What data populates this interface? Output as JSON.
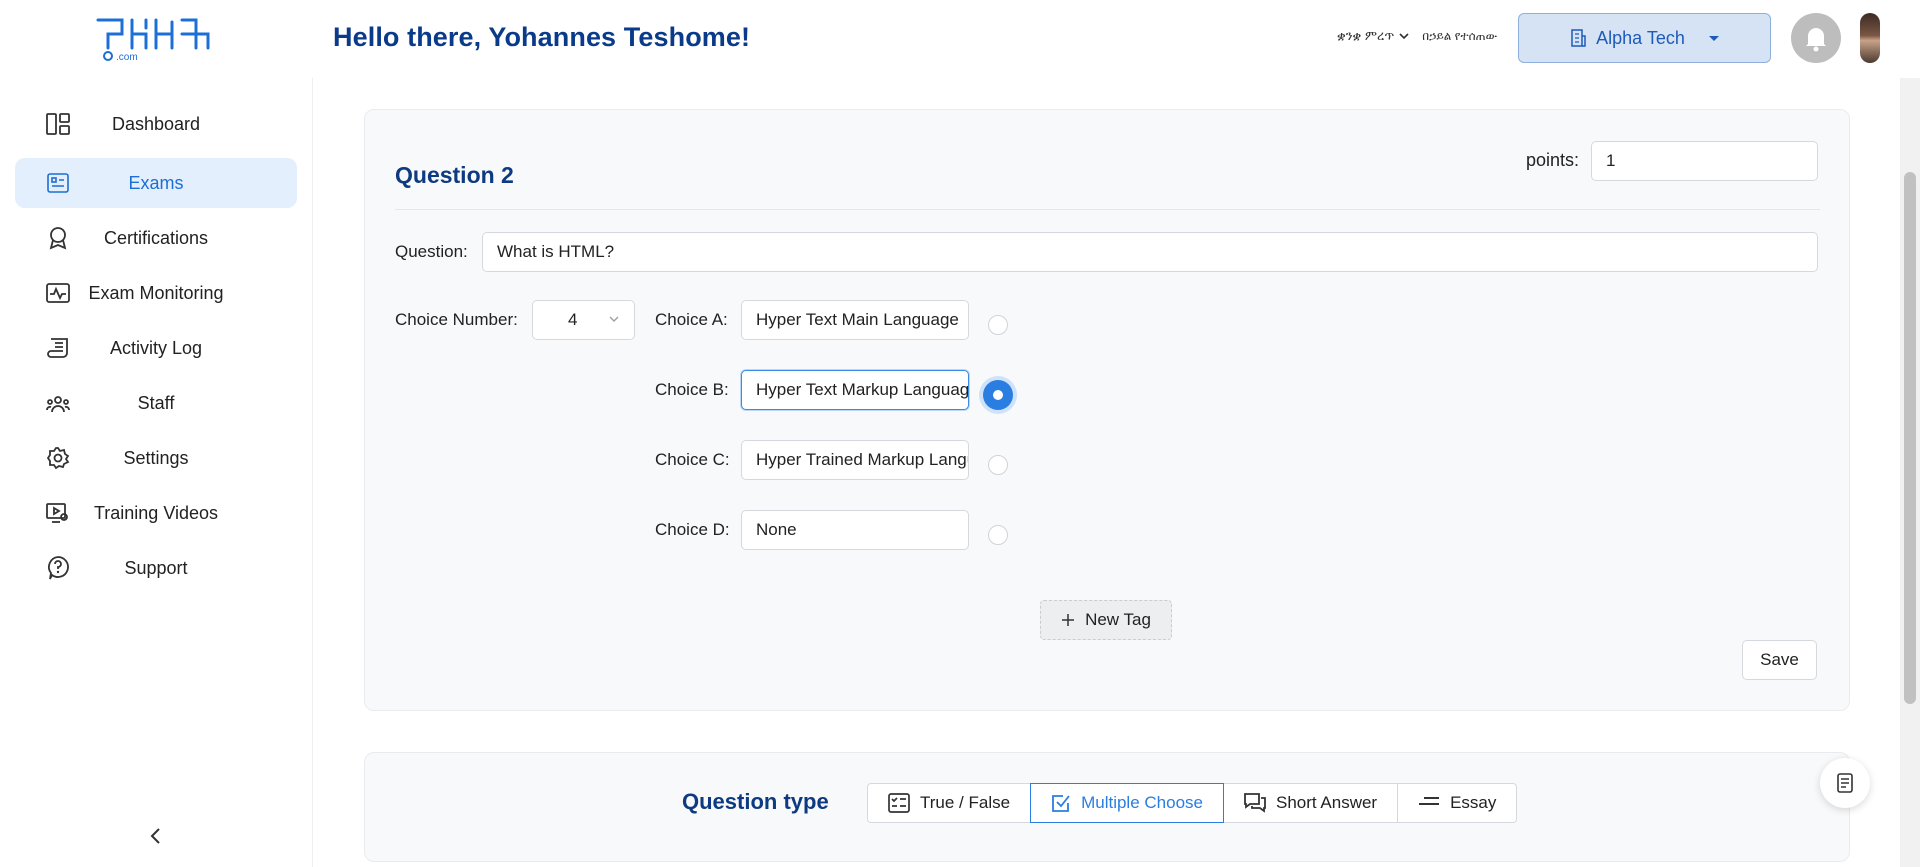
{
  "header": {
    "greeting": "Hello there, Yohannes Teshome!",
    "language_label": "ቋንቋ ምረጥ",
    "faq_label": "በኃይል የተሰጠው",
    "company_button": "Alpha Tech"
  },
  "sidebar": {
    "items": [
      {
        "label": "Dashboard",
        "icon": "dashboard-icon"
      },
      {
        "label": "Exams",
        "icon": "exam-icon",
        "active": true
      },
      {
        "label": "Certifications",
        "icon": "award-icon"
      },
      {
        "label": "Exam Monitoring",
        "icon": "monitor-icon"
      },
      {
        "label": "Activity Log",
        "icon": "log-icon"
      },
      {
        "label": "Staff",
        "icon": "staff-icon"
      },
      {
        "label": "Settings",
        "icon": "gear-icon"
      },
      {
        "label": "Training Videos",
        "icon": "video-icon"
      },
      {
        "label": "Support",
        "icon": "help-icon"
      }
    ]
  },
  "question": {
    "title": "Question 2",
    "points_label": "points",
    "points_value": "1",
    "question_label": "Question",
    "question_value": "What is HTML?",
    "choice_number_label": "Choice Number",
    "choice_number_value": "4",
    "choices": [
      {
        "label": "Choice A",
        "value": "Hyper Text Main Language",
        "correct": false
      },
      {
        "label": "Choice B",
        "value": "Hyper Text Markup Language",
        "correct": true
      },
      {
        "label": "Choice C",
        "value": "Hyper Trained Markup Language",
        "correct": false
      },
      {
        "label": "Choice D",
        "value": "None",
        "correct": false
      }
    ],
    "new_tag_label": "New Tag",
    "save_label": "Save"
  },
  "question_type": {
    "label": "Question type",
    "tabs": [
      {
        "label": "True / False",
        "icon": "true-false-icon"
      },
      {
        "label": "Multiple Choose",
        "icon": "checkbox-icon",
        "active": true
      },
      {
        "label": "Short Answer",
        "icon": "chat-icon"
      },
      {
        "label": "Essay",
        "icon": "text-lines-icon"
      }
    ]
  },
  "colors": {
    "brand_blue": "#0d3a80",
    "accent": "#2a7de1",
    "active_bg": "#e3effd"
  }
}
